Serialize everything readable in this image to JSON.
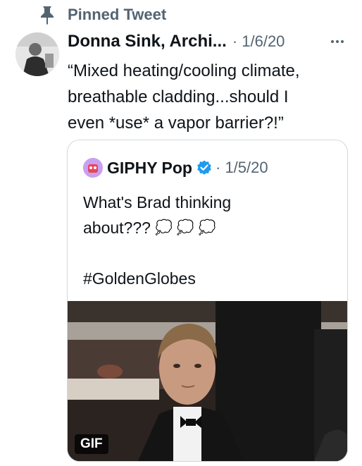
{
  "pinned": {
    "label": "Pinned Tweet",
    "icon": "pin-icon"
  },
  "tweet": {
    "author": "Donna Sink, Archi...",
    "date": "· 1/6/20",
    "more_icon": "more-icon",
    "lines": [
      "“Mixed heating/cooling climate,",
      "breathable cladding...should I",
      "even *use* a vapor barrier?!”"
    ]
  },
  "quote": {
    "author": "GIPHY Pop",
    "verified_icon": "verified-badge-icon",
    "date": "· 1/5/20",
    "lines": [
      "What's Brad thinking",
      "about???"
    ],
    "thought_bubbles": [
      "💭",
      "💭",
      "💭"
    ],
    "hashtag": "#GoldenGlobes",
    "media_badge": "GIF"
  },
  "colors": {
    "text": "#0f1419",
    "secondary": "#536471",
    "verified": "#1d9bf0",
    "border": "#cfd9de"
  }
}
